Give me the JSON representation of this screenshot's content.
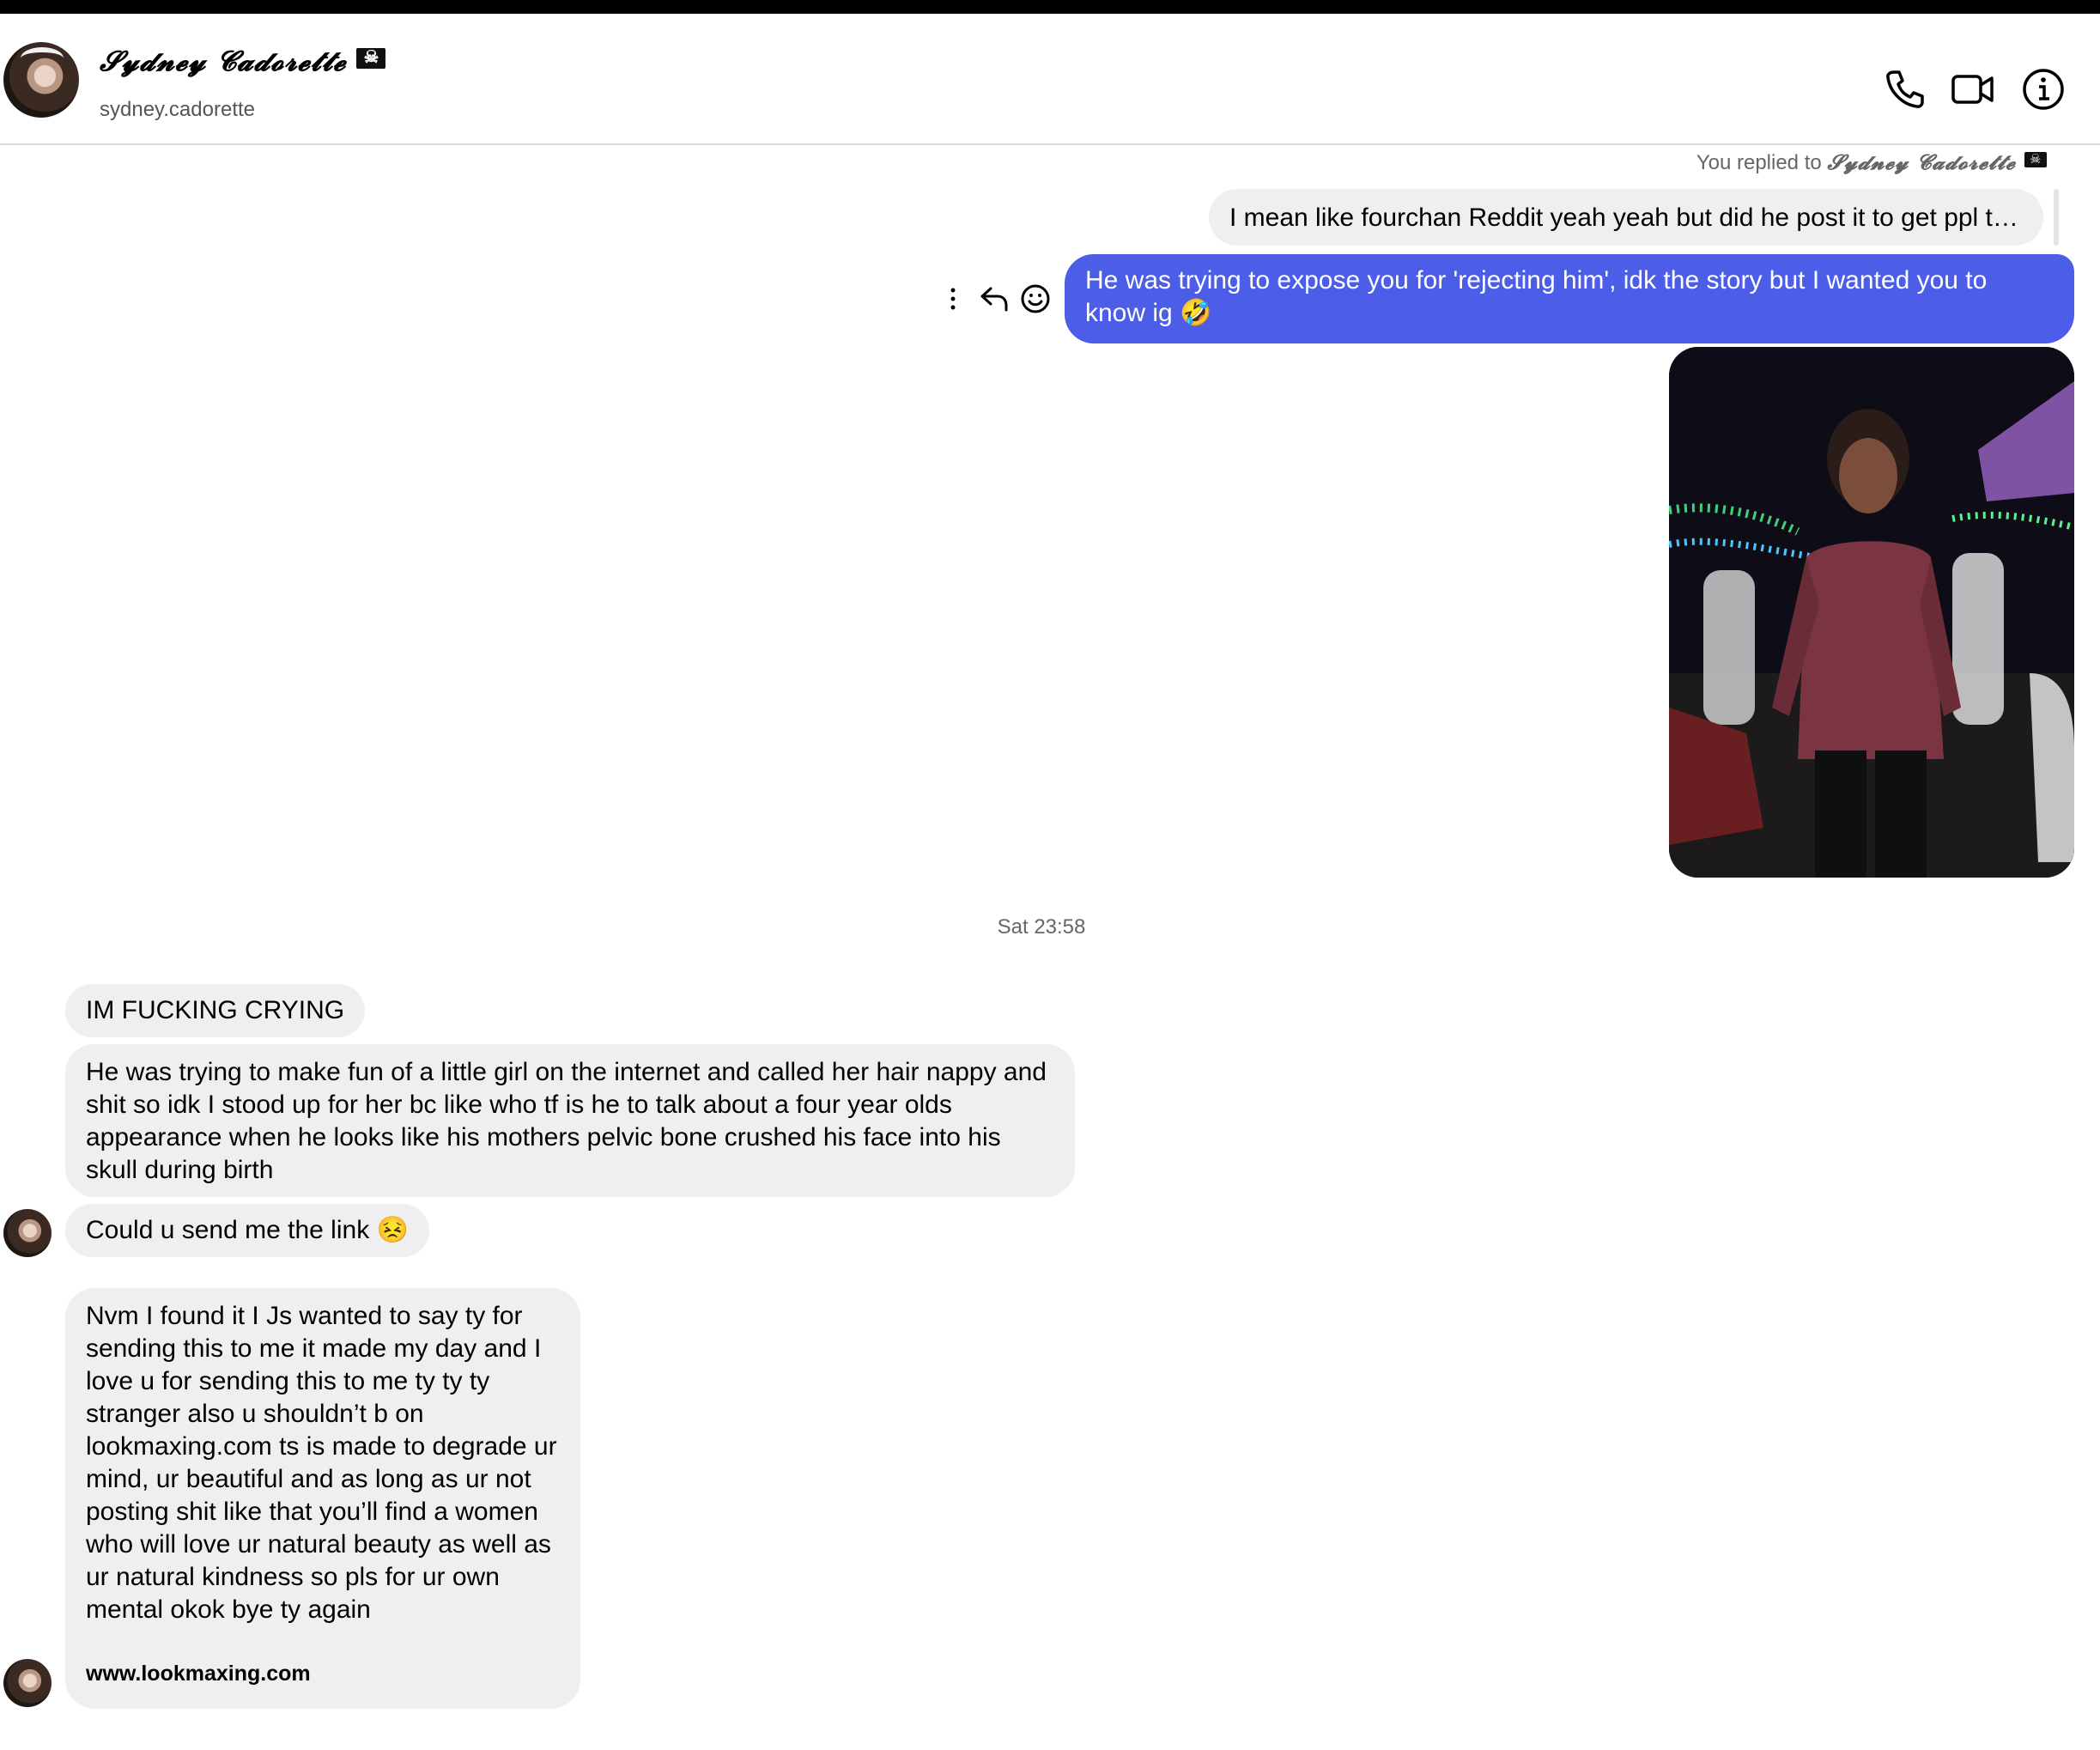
{
  "header": {
    "contact_name": "𝓢𝔂𝓭𝓷𝓮𝔂 𝓒𝓪𝓭𝓸𝓻𝓮𝓽𝓽𝓮",
    "username": "sydney.cadorette",
    "icons": [
      "phone-icon",
      "video-call-icon",
      "info-icon"
    ]
  },
  "thread": {
    "reply_meta_prefix": "You replied to",
    "reply_meta_name": "𝓢𝔂𝓭𝓷𝓮𝔂 𝓒𝓪𝓭𝓸𝓻𝓮𝓽𝓽𝓮",
    "quoted_text": "I mean like fourchan Reddit yeah yeah but did he post it to get ppl to h...",
    "sent_message": "He was trying to expose you for 'rejecting him', idk the story but I wanted you to know ig 🤣",
    "message_actions": [
      "more-options-icon",
      "reply-icon",
      "react-emoji-icon"
    ],
    "timestamp": "Sat 23:58",
    "received": [
      {
        "text": "IM FUCKING CRYING"
      },
      {
        "text": "He was trying to make fun of a little girl on the internet and called her hair nappy and shit so idk I stood up for her bc like who tf is he to talk about a four year olds appearance when he looks like his mothers pelvic bone crushed his face into his skull during birth"
      },
      {
        "text": "Could u send me the link 😣"
      },
      {
        "text": "Nvm I found it I Js wanted to say ty for sending this to me it made my day and I love u for sending this to me ty ty ty stranger also u shouldn’t b on lookmaxing.com ts is made to degrade ur mind, ur beautiful and as long as ur not posting shit like that you’ll find a women who will love ur natural beauty as well as ur natural kindness so pls for ur own mental okok bye ty again",
        "link": "www.lookmaxing.com"
      }
    ]
  },
  "colors": {
    "sent_bubble": "#4c5de8",
    "received_bubble": "#efeff2",
    "header_border": "#dbdbdb"
  }
}
